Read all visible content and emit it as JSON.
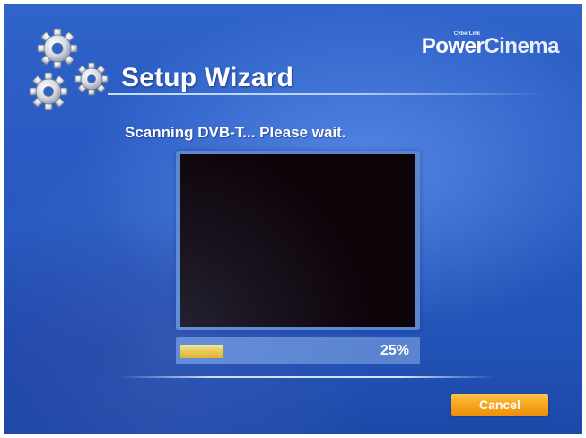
{
  "brand": {
    "cyberlink": "CyberLink",
    "power": "Power",
    "cinema": "Cinema"
  },
  "wizard": {
    "title": "Setup Wizard",
    "status": "Scanning DVB-T... Please wait."
  },
  "progress": {
    "label": "25%",
    "fraction": 0.25
  },
  "buttons": {
    "cancel_label": "Cancel"
  },
  "colors": {
    "background": "#2a5bc4",
    "accent_orange": "#f6a61e",
    "progress_yellow": "#f7cf3e",
    "preview_black": "#0d0208"
  },
  "icons": {
    "logo": "gears-icon"
  }
}
